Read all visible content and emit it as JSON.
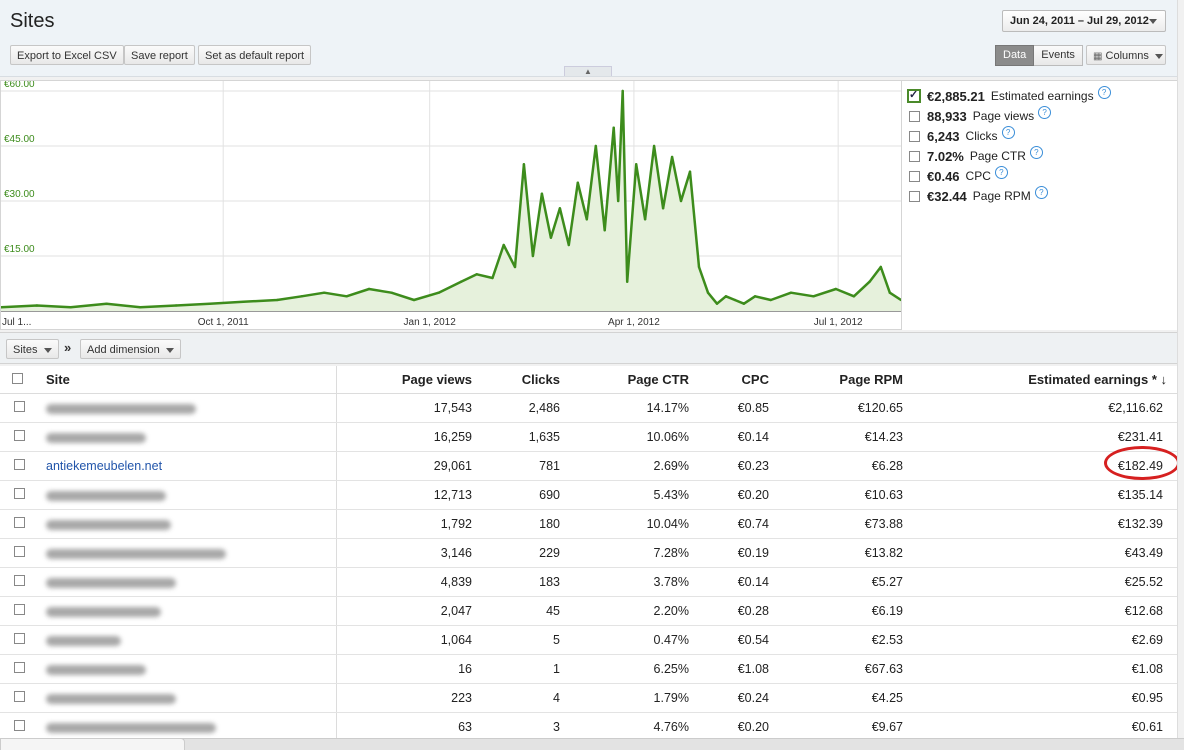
{
  "header": {
    "title": "Sites",
    "date_range": "Jun 24, 2011 – Jul 29, 2012",
    "export_label": "Export to Excel CSV",
    "save_label": "Save report",
    "default_label": "Set as default report",
    "data_label": "Data",
    "events_label": "Events",
    "columns_label": "Columns"
  },
  "metrics": [
    {
      "value": "€2,885.21",
      "label": "Estimated earnings",
      "checked": true
    },
    {
      "value": "88,933",
      "label": "Page views",
      "checked": false
    },
    {
      "value": "6,243",
      "label": "Clicks",
      "checked": false
    },
    {
      "value": "7.02%",
      "label": "Page CTR",
      "checked": false
    },
    {
      "value": "€0.46",
      "label": "CPC",
      "checked": false
    },
    {
      "value": "€32.44",
      "label": "Page RPM",
      "checked": false
    }
  ],
  "dimension_bar": {
    "sites_label": "Sites",
    "separator": "»",
    "add_dimension_label": "Add dimension"
  },
  "table": {
    "headers": [
      "Site",
      "Page views",
      "Clicks",
      "Page CTR",
      "CPC",
      "Page RPM",
      "Estimated earnings"
    ],
    "sort_indicator": "* ↓",
    "rows": [
      {
        "site": "",
        "page_views": "17,543",
        "clicks": "2,486",
        "ctr": "14.17%",
        "cpc": "€0.85",
        "rpm": "€120.65",
        "earnings": "€2,116.62"
      },
      {
        "site": "",
        "page_views": "16,259",
        "clicks": "1,635",
        "ctr": "10.06%",
        "cpc": "€0.14",
        "rpm": "€14.23",
        "earnings": "€231.41"
      },
      {
        "site": "antiekemeubelen.net",
        "page_views": "29,061",
        "clicks": "781",
        "ctr": "2.69%",
        "cpc": "€0.23",
        "rpm": "€6.28",
        "earnings": "€182.49"
      },
      {
        "site": "",
        "page_views": "12,713",
        "clicks": "690",
        "ctr": "5.43%",
        "cpc": "€0.20",
        "rpm": "€10.63",
        "earnings": "€135.14"
      },
      {
        "site": "",
        "page_views": "1,792",
        "clicks": "180",
        "ctr": "10.04%",
        "cpc": "€0.74",
        "rpm": "€73.88",
        "earnings": "€132.39"
      },
      {
        "site": "",
        "page_views": "3,146",
        "clicks": "229",
        "ctr": "7.28%",
        "cpc": "€0.19",
        "rpm": "€13.82",
        "earnings": "€43.49"
      },
      {
        "site": "",
        "page_views": "4,839",
        "clicks": "183",
        "ctr": "3.78%",
        "cpc": "€0.14",
        "rpm": "€5.27",
        "earnings": "€25.52"
      },
      {
        "site": "",
        "page_views": "2,047",
        "clicks": "45",
        "ctr": "2.20%",
        "cpc": "€0.28",
        "rpm": "€6.19",
        "earnings": "€12.68"
      },
      {
        "site": "",
        "page_views": "1,064",
        "clicks": "5",
        "ctr": "0.47%",
        "cpc": "€0.54",
        "rpm": "€2.53",
        "earnings": "€2.69"
      },
      {
        "site": "",
        "page_views": "16",
        "clicks": "1",
        "ctr": "6.25%",
        "cpc": "€1.08",
        "rpm": "€67.63",
        "earnings": "€1.08"
      },
      {
        "site": "",
        "page_views": "223",
        "clicks": "4",
        "ctr": "1.79%",
        "cpc": "€0.24",
        "rpm": "€4.25",
        "earnings": "€0.95"
      },
      {
        "site": "",
        "page_views": "63",
        "clicks": "3",
        "ctr": "4.76%",
        "cpc": "€0.20",
        "rpm": "€9.67",
        "earnings": "€0.61"
      }
    ]
  },
  "colors": {
    "series": "#3d8c1c",
    "fill": "#e6f1dc",
    "ylabel": "#3d8c1c",
    "link": "#2255aa",
    "highlight_ring": "#d62020"
  },
  "icons": {
    "help": "question-circle-icon",
    "dropdown": "chevron-down-icon",
    "columns": "grid-columns-icon",
    "collapse": "chevron-up-icon"
  },
  "chart_data": {
    "type": "area",
    "title": "",
    "xlabel": "",
    "ylabel": "",
    "ylim": [
      0,
      60
    ],
    "yticks": [
      "€15.00",
      "€30.00",
      "€45.00",
      "€60.00"
    ],
    "ytick_values": [
      15,
      30,
      45,
      60
    ],
    "xticks": [
      "Jul 1...",
      "Oct 1, 2011",
      "Jan 1, 2012",
      "Apr 1, 2012",
      "Jul 1, 2012"
    ],
    "x_start": "2011-06-24",
    "x_end": "2012-07-29",
    "grid": true,
    "series": [
      {
        "name": "Estimated earnings",
        "x": [
          "2011-06-24",
          "2011-07-10",
          "2011-07-25",
          "2011-08-10",
          "2011-08-25",
          "2011-09-10",
          "2011-09-25",
          "2011-10-10",
          "2011-10-25",
          "2011-11-05",
          "2011-11-15",
          "2011-11-25",
          "2011-12-05",
          "2011-12-15",
          "2011-12-25",
          "2012-01-05",
          "2012-01-15",
          "2012-01-22",
          "2012-01-29",
          "2012-02-03",
          "2012-02-08",
          "2012-02-12",
          "2012-02-16",
          "2012-02-20",
          "2012-02-24",
          "2012-02-28",
          "2012-03-03",
          "2012-03-07",
          "2012-03-11",
          "2012-03-15",
          "2012-03-19",
          "2012-03-23",
          "2012-03-25",
          "2012-03-27",
          "2012-03-29",
          "2012-04-02",
          "2012-04-06",
          "2012-04-10",
          "2012-04-14",
          "2012-04-18",
          "2012-04-22",
          "2012-04-26",
          "2012-04-30",
          "2012-05-04",
          "2012-05-08",
          "2012-05-12",
          "2012-05-16",
          "2012-05-20",
          "2012-05-25",
          "2012-06-01",
          "2012-06-10",
          "2012-06-20",
          "2012-06-30",
          "2012-07-08",
          "2012-07-15",
          "2012-07-20",
          "2012-07-24",
          "2012-07-29"
        ],
        "values": [
          1,
          1.5,
          1,
          2,
          1,
          1.5,
          2,
          2.5,
          3,
          4,
          5,
          4,
          6,
          5,
          3,
          5,
          8,
          10,
          9,
          18,
          12,
          40,
          15,
          32,
          20,
          28,
          18,
          35,
          25,
          45,
          22,
          50,
          30,
          60,
          8,
          40,
          25,
          45,
          28,
          42,
          30,
          38,
          12,
          5,
          2,
          4,
          3,
          2,
          4,
          3,
          5,
          4,
          6,
          4,
          8,
          12,
          5,
          3
        ]
      }
    ]
  }
}
